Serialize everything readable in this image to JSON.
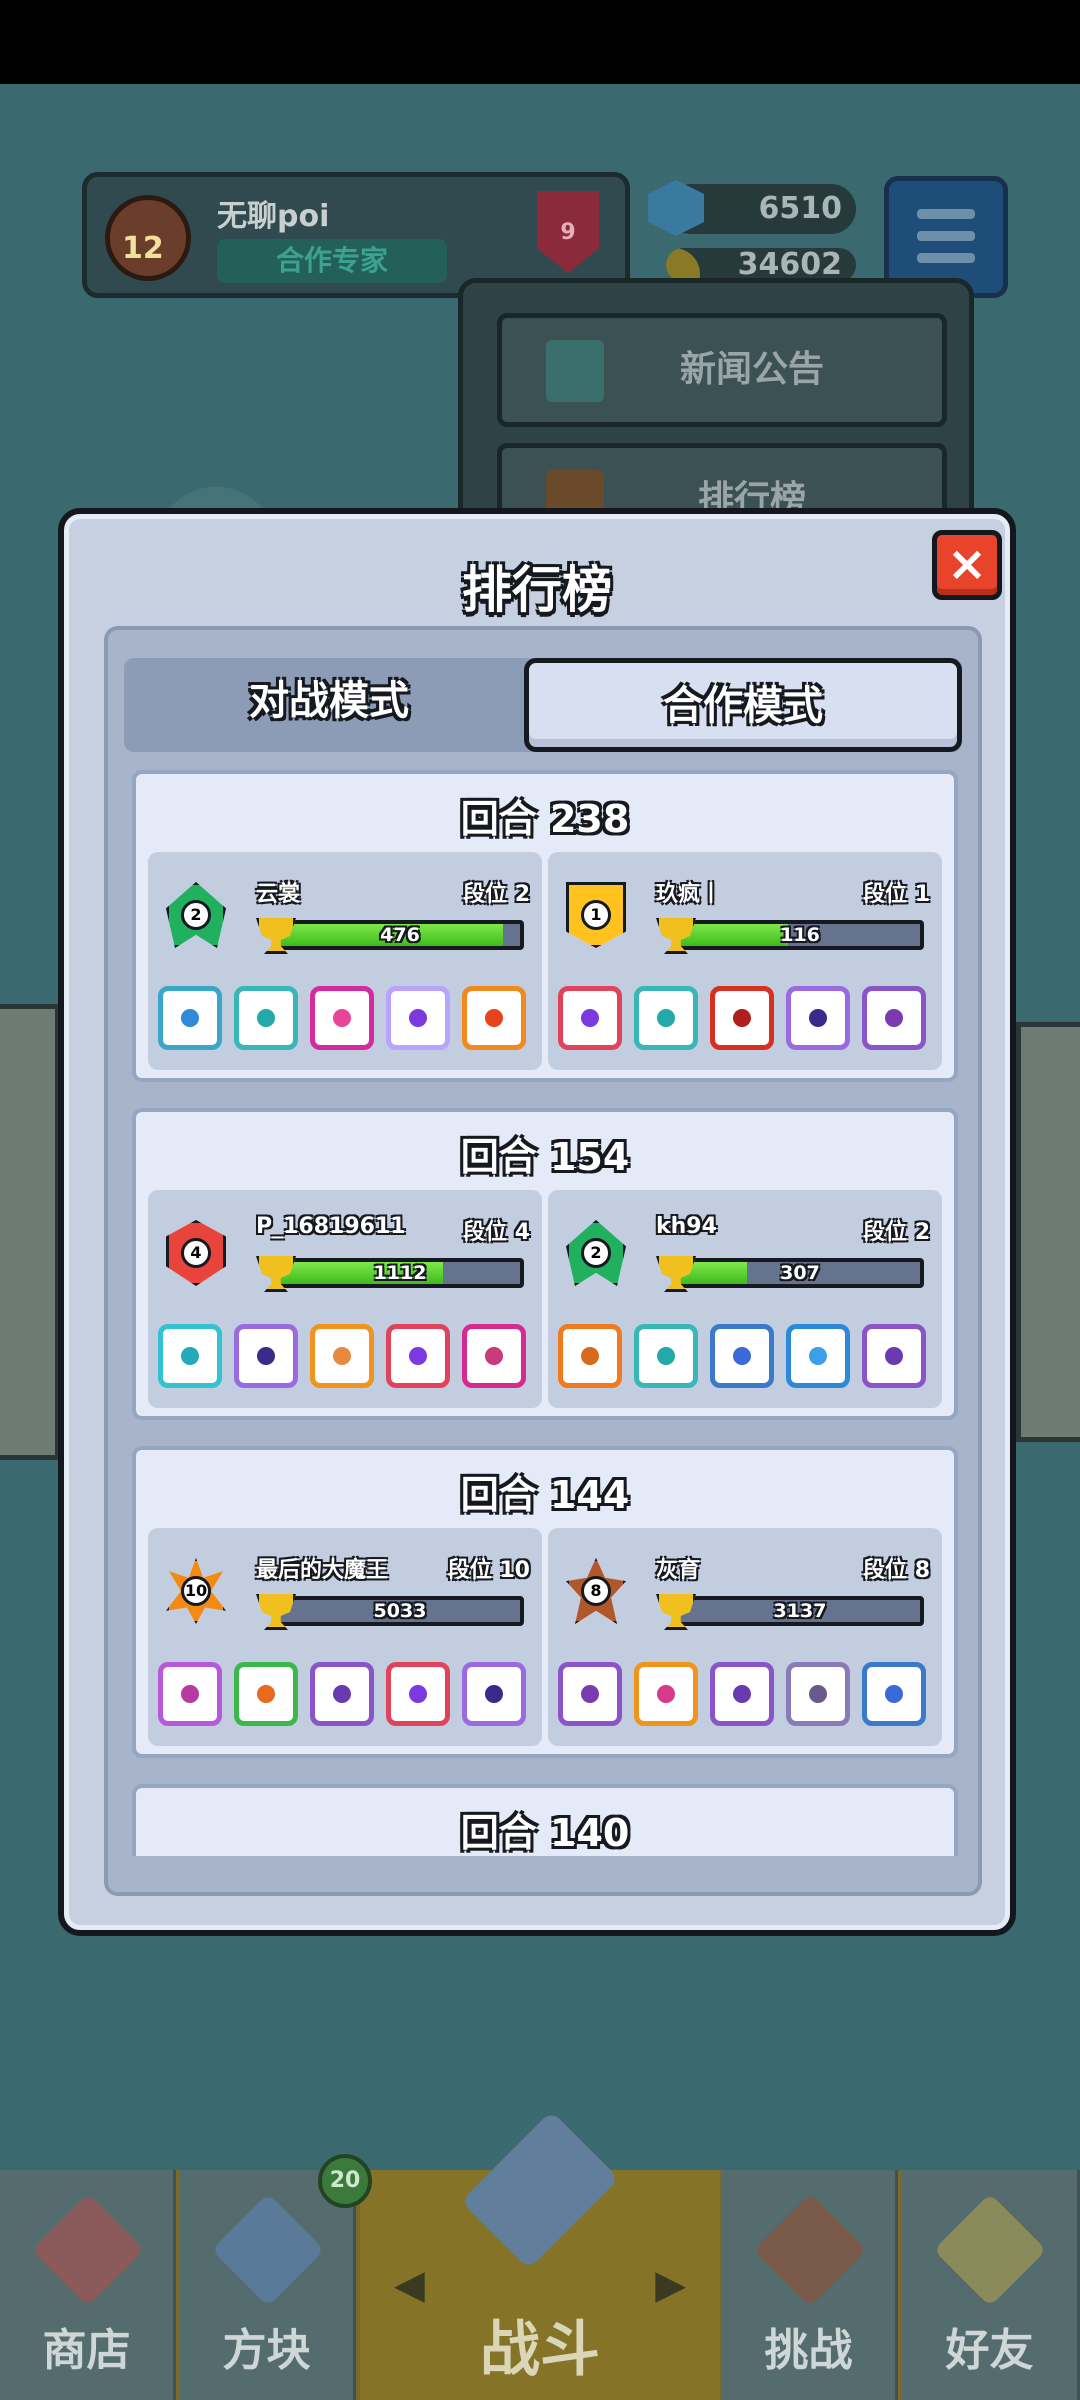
{
  "background": {
    "profile": {
      "name": "无聊poi",
      "level": "12",
      "title": "合作专家",
      "rank_badge": "9"
    },
    "gems": "6510",
    "coins": "34602",
    "dropdown": {
      "items": [
        {
          "label": "新闻公告"
        },
        {
          "label": "排行榜"
        }
      ]
    },
    "nav": {
      "shop_label": "商店",
      "blocks_label": "方块",
      "blocks_badge": "20",
      "battle_label": "战斗",
      "challenge_label": "挑战",
      "friends_label": "好友"
    }
  },
  "modal": {
    "title": "排行榜",
    "close_icon": "×",
    "tabs": [
      {
        "label": "对战模式"
      },
      {
        "label": "合作模式"
      }
    ],
    "active_tab": 1
  },
  "rounds": [
    {
      "title": "回合 238",
      "players": [
        {
          "medal": "green",
          "medal_num": "2",
          "name": "云裳",
          "rank": "段位 2",
          "score": "476",
          "progress": 0.93,
          "dice": [
            {
              "border": "#3aa6c8",
              "pip": "#2e8bd8"
            },
            {
              "border": "#37b7b7",
              "pip": "#23a9a9"
            },
            {
              "border": "#d52ba0",
              "pip": "#e8449a"
            },
            {
              "border": "#b8a3ff",
              "pip": "#7a3ae0"
            },
            {
              "border": "#f08a1c",
              "pip": "#e8441c"
            }
          ]
        },
        {
          "medal": "gold",
          "medal_num": "1",
          "name": "玖疯丨",
          "rank": "段位 1",
          "score": "116",
          "progress": 0.45,
          "dice": [
            {
              "border": "#e1445a",
              "pip": "#7a3ae0"
            },
            {
              "border": "#37b7b7",
              "pip": "#23a9a9"
            },
            {
              "border": "#d8301e",
              "pip": "#b01e1e"
            },
            {
              "border": "#9b6ae0",
              "pip": "#3a2a8a"
            },
            {
              "border": "#8b55c8",
              "pip": "#7a3ab0"
            }
          ]
        }
      ]
    },
    {
      "title": "回合 154",
      "players": [
        {
          "medal": "red",
          "medal_num": "4",
          "name": "P_16819611",
          "rank": "段位 4",
          "score": "1112",
          "progress": 0.68,
          "dice": [
            {
              "border": "#33c3d0",
              "pip": "#23a9b9"
            },
            {
              "border": "#9b6ae0",
              "pip": "#3a2a8a"
            },
            {
              "border": "#f0941e",
              "pip": "#e88a3c"
            },
            {
              "border": "#e1445a",
              "pip": "#7a3ae0"
            },
            {
              "border": "#d52b90",
              "pip": "#c83a7a"
            }
          ]
        },
        {
          "medal": "green",
          "medal_num": "2",
          "name": "kh94",
          "rank": "段位 2",
          "score": "307",
          "progress": 0.28,
          "dice": [
            {
              "border": "#f07a1e",
              "pip": "#d86a1e"
            },
            {
              "border": "#37b7b7",
              "pip": "#23a9a9"
            },
            {
              "border": "#3a7ac8",
              "pip": "#3a6ad8"
            },
            {
              "border": "#2a8ad8",
              "pip": "#3aa0e8"
            },
            {
              "border": "#8b55c8",
              "pip": "#6a3ab0"
            }
          ]
        }
      ]
    },
    {
      "title": "回合 144",
      "players": [
        {
          "medal": "star",
          "medal_num": "10",
          "name": "最后的大魔王",
          "rank": "段位 10",
          "score": "5033",
          "progress": 0.0,
          "dice": [
            {
              "border": "#b85ad8",
              "pip": "#b83aa0"
            },
            {
              "border": "#3ab84a",
              "pip": "#e86a1e"
            },
            {
              "border": "#8b55c8",
              "pip": "#6a3ab0"
            },
            {
              "border": "#e1445a",
              "pip": "#7a3ae0"
            },
            {
              "border": "#9b6ae0",
              "pip": "#3a2a8a"
            }
          ]
        },
        {
          "medal": "brown",
          "medal_num": "8",
          "name": "灰育",
          "rank": "段位 8",
          "score": "3137",
          "progress": 0.0,
          "dice": [
            {
              "border": "#8b55c8",
              "pip": "#7a3ab0"
            },
            {
              "border": "#f0941e",
              "pip": "#d83a8a"
            },
            {
              "border": "#8b55c8",
              "pip": "#6a3ab0"
            },
            {
              "border": "#8a7ab8",
              "pip": "#6a5a8a"
            },
            {
              "border": "#3a7ac8",
              "pip": "#3a6ad8"
            }
          ]
        }
      ]
    },
    {
      "title": "回合 140",
      "players": []
    }
  ],
  "colors": {
    "accent_green": "#3fbb1c",
    "close_red": "#e8442c",
    "panel": "#c6d0e0"
  }
}
